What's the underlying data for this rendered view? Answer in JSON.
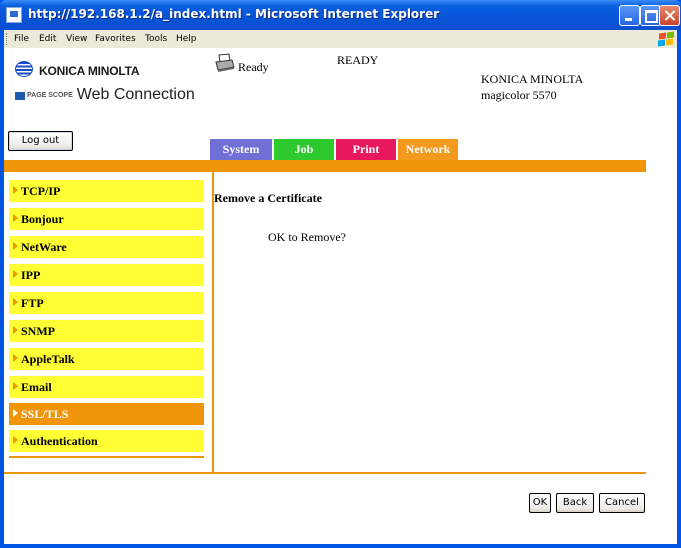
{
  "window": {
    "title": "http://192.168.1.2/a_index.html - Microsoft Internet Explorer",
    "icon": "ie-page-icon"
  },
  "menubar": {
    "items": [
      "File",
      "Edit",
      "View",
      "Favorites",
      "Tools",
      "Help"
    ]
  },
  "header": {
    "brand_logo": "KONICA MINOLTA",
    "product_logo_small": "PAGE SCOPE",
    "product_logo": "Web Connection",
    "status_short": "Ready",
    "status_panel": "READY",
    "device_brand": "KONICA MINOLTA",
    "device_model": "magicolor 5570",
    "logout_label": "Log out"
  },
  "tabs": [
    {
      "label": "System",
      "color": "#6f6fd6"
    },
    {
      "label": "Job",
      "color": "#2ec92e"
    },
    {
      "label": "Print",
      "color": "#e8185f"
    },
    {
      "label": "Network",
      "color": "#f39a1e"
    }
  ],
  "sidebar": {
    "items": [
      {
        "label": "TCP/IP",
        "active": false
      },
      {
        "label": "Bonjour",
        "active": false
      },
      {
        "label": "NetWare",
        "active": false
      },
      {
        "label": "IPP",
        "active": false
      },
      {
        "label": "FTP",
        "active": false
      },
      {
        "label": "SNMP",
        "active": false
      },
      {
        "label": "AppleTalk",
        "active": false
      },
      {
        "label": "Email",
        "active": false
      },
      {
        "label": "SSL/TLS",
        "active": true
      },
      {
        "label": "Authentication",
        "active": false
      }
    ]
  },
  "main": {
    "title": "Remove a Certificate",
    "message": "OK to Remove?"
  },
  "actions": {
    "ok_label": "OK",
    "back_label": "Back",
    "cancel_label": "Cancel"
  },
  "colors": {
    "accent": "#f0940a",
    "sidebar_bg": "#ffff33",
    "titlebar": "#0a5ee0"
  }
}
